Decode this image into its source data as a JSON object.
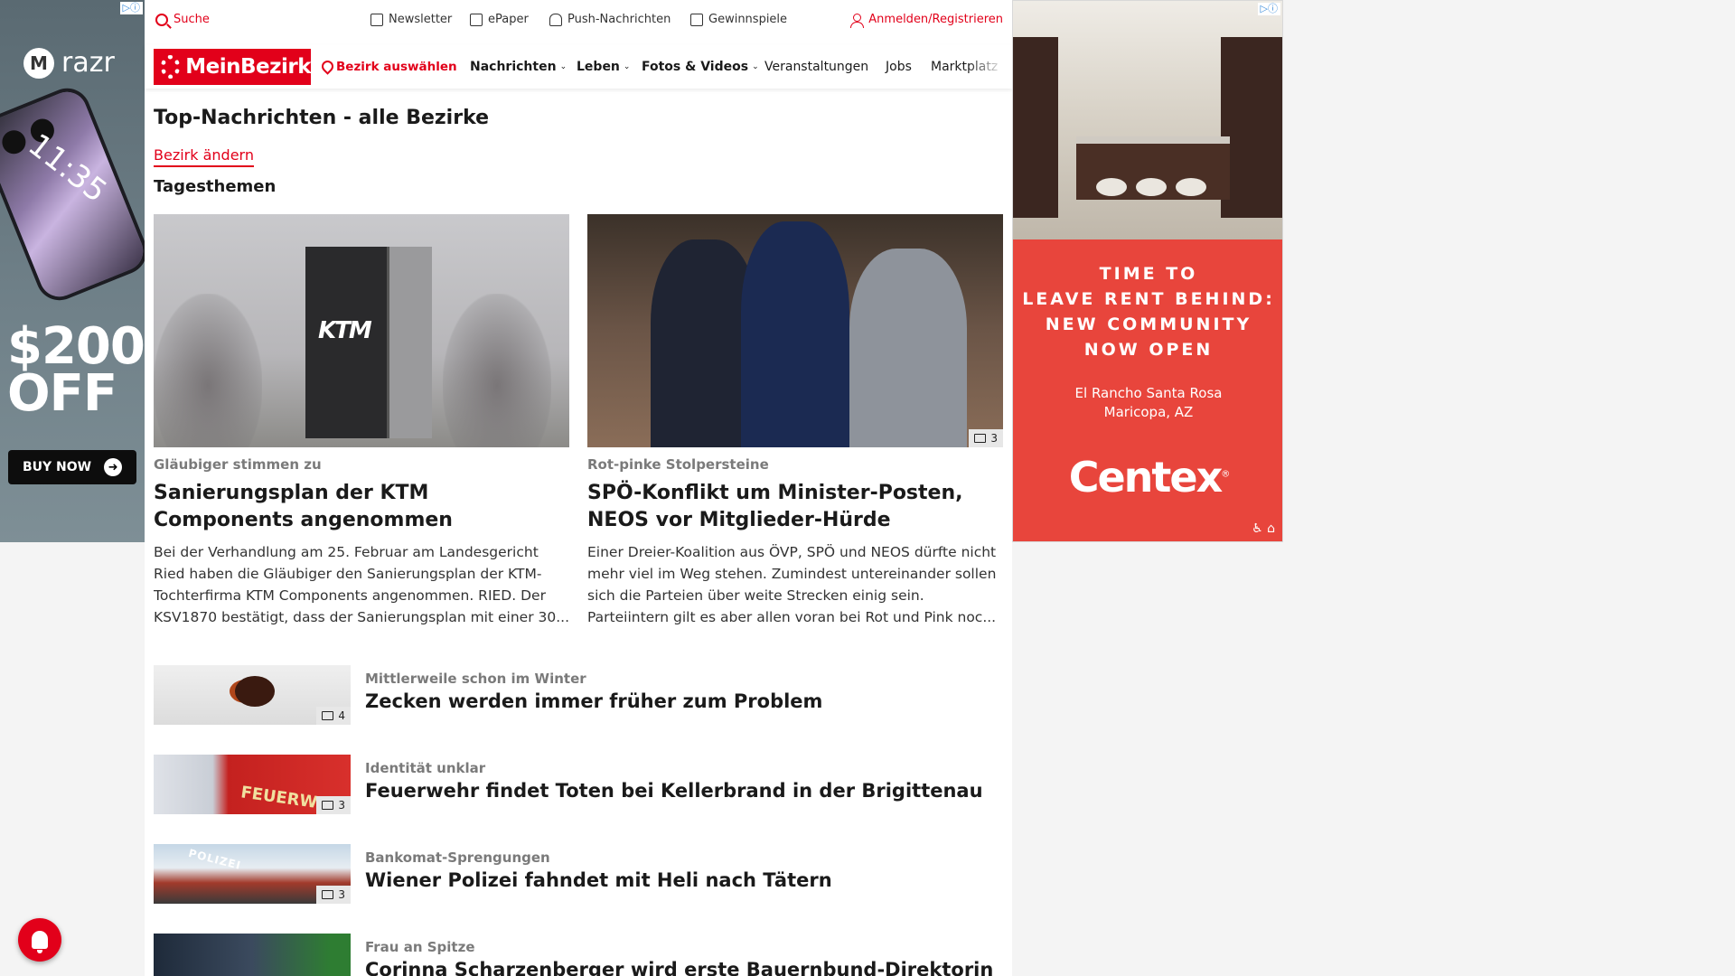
{
  "ads": {
    "left": {
      "brand": "razr",
      "clock": "11:35",
      "offer_line1": "$200",
      "offer_line2": "OFF",
      "cta": "BUY NOW",
      "ad_choice": "▷ⓘ"
    },
    "right": {
      "headline_lines": [
        "TIME TO",
        "LEAVE RENT BEHIND:",
        "NEW COMMUNITY",
        "NOW OPEN"
      ],
      "location_lines": [
        "El Rancho Santa Rosa",
        "Maricopa, AZ"
      ],
      "brand": "Centex",
      "ad_choice": "▷ⓘ",
      "access_icons": "♿ ⌂"
    }
  },
  "topbar": {
    "search": "Suche",
    "newsletter": "Newsletter",
    "epaper": "ePaper",
    "push": "Push-Nachrichten",
    "gewinnspiele": "Gewinnspiele",
    "login": "Anmelden/Registrieren"
  },
  "nav": {
    "logo": "MeinBezirk",
    "bezirk": "Bezirk auswählen",
    "items": [
      "Nachrichten",
      "Leben",
      "Fotos & Videos",
      "Veranstaltungen",
      "Jobs",
      "Marktplatz"
    ]
  },
  "page": {
    "title": "Top-Nachrichten - alle Bezirke",
    "change_link": "Bezirk ändern",
    "section": "Tagesthemen"
  },
  "featured": [
    {
      "kicker": "Gläubiger stimmen zu",
      "headline": "Sanierungsplan der KTM Components angenommen",
      "teaser": "Bei der Verhandlung am 25. Februar am Landesgericht Ried haben die Gläubiger den Sanierungsplan der KTM-Tochterfirma KTM Components angenommen. RIED. Der KSV1870 bestätigt, dass der Sanierungsplan mit einer 30...",
      "image_text": "KTM",
      "gallery_count": ""
    },
    {
      "kicker": "Rot-pinke Stolpersteine",
      "headline": "SPÖ-Konflikt um Minister-Posten, NEOS vor Mitglieder-Hürde",
      "teaser": "Einer Dreier-Koalition aus ÖVP, SPÖ und NEOS dürfte nicht mehr viel im Weg stehen. Zumindest untereinander sollen sich die Parteien über weite Strecken einig sein. Parteiintern gilt es aber allen voran bei Rot und Pink noc...",
      "gallery_count": "3"
    }
  ],
  "list": [
    {
      "kicker": "Mittlerweile schon im Winter",
      "headline": "Zecken werden immer früher zum Problem",
      "gallery_count": "4"
    },
    {
      "kicker": "Identität unklar",
      "headline": "Feuerwehr findet Toten bei Kellerbrand in der Brigittenau",
      "gallery_count": "3",
      "image_text": "FEUERWEHR"
    },
    {
      "kicker": "Bankomat-Sprengungen",
      "headline": "Wiener Polizei fahndet mit Heli nach Tätern",
      "gallery_count": "3",
      "image_text": "POLIZEI"
    },
    {
      "kicker": "Frau an Spitze",
      "headline": "Corinna Scharzenberger wird erste Bauernbund-Direktorin",
      "gallery_count": ""
    }
  ],
  "colors": {
    "accent": "#e2001a",
    "ad_right_bg": "#e8453c"
  }
}
